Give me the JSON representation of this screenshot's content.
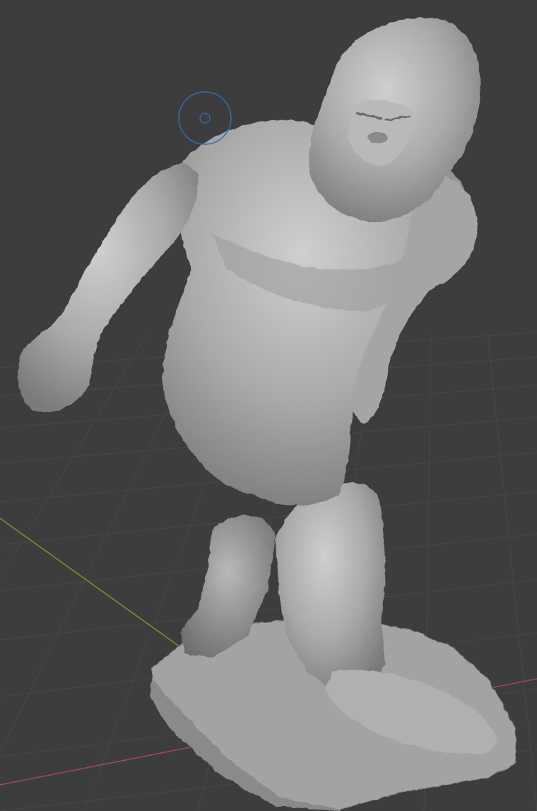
{
  "viewport": {
    "mode": "sculpt",
    "background_color": "#3d3d3d",
    "grid_color": "#4a4a4a",
    "x_axis_color": "#a84a52",
    "y_axis_color": "#6f9a2e",
    "brush_cursor_color": "#2f6fb6",
    "mesh_color": "#b3b3b3"
  },
  "icons": {
    "brush_cursor": "brush-cursor-icon"
  }
}
